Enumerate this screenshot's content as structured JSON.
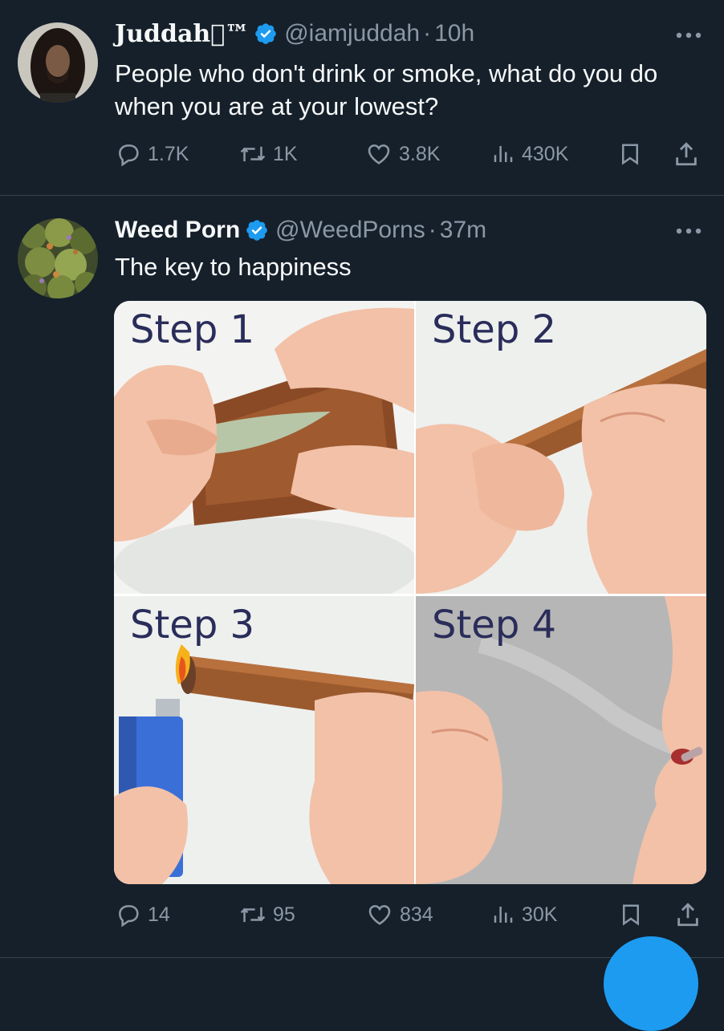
{
  "tweets": [
    {
      "name": "Juddah™",
      "handle": "@iamjuddah",
      "time": "10h",
      "text": "People who don't drink or smoke, what do you do when you are at your lowest?",
      "stats": {
        "replies": "1.7K",
        "reposts": "1K",
        "likes": "3.8K",
        "views": "430K"
      }
    },
    {
      "name": "Weed Porn",
      "handle": "@WeedPorns",
      "time": "37m",
      "text": "The key to happiness",
      "media": {
        "steps": [
          "Step 1",
          "Step 2",
          "Step 3",
          "Step 4"
        ]
      },
      "stats": {
        "replies": "14",
        "reposts": "95",
        "likes": "834",
        "views": "30K"
      }
    }
  ],
  "colors": {
    "background": "#15202b",
    "text_primary": "#f7f9f9",
    "text_secondary": "#8b98a5",
    "verified": "#1d9bf0",
    "divider": "#38444d"
  },
  "icons": [
    "verified-badge-icon",
    "more-icon",
    "reply-icon",
    "repost-icon",
    "like-icon",
    "views-icon",
    "bookmark-icon",
    "share-icon"
  ]
}
